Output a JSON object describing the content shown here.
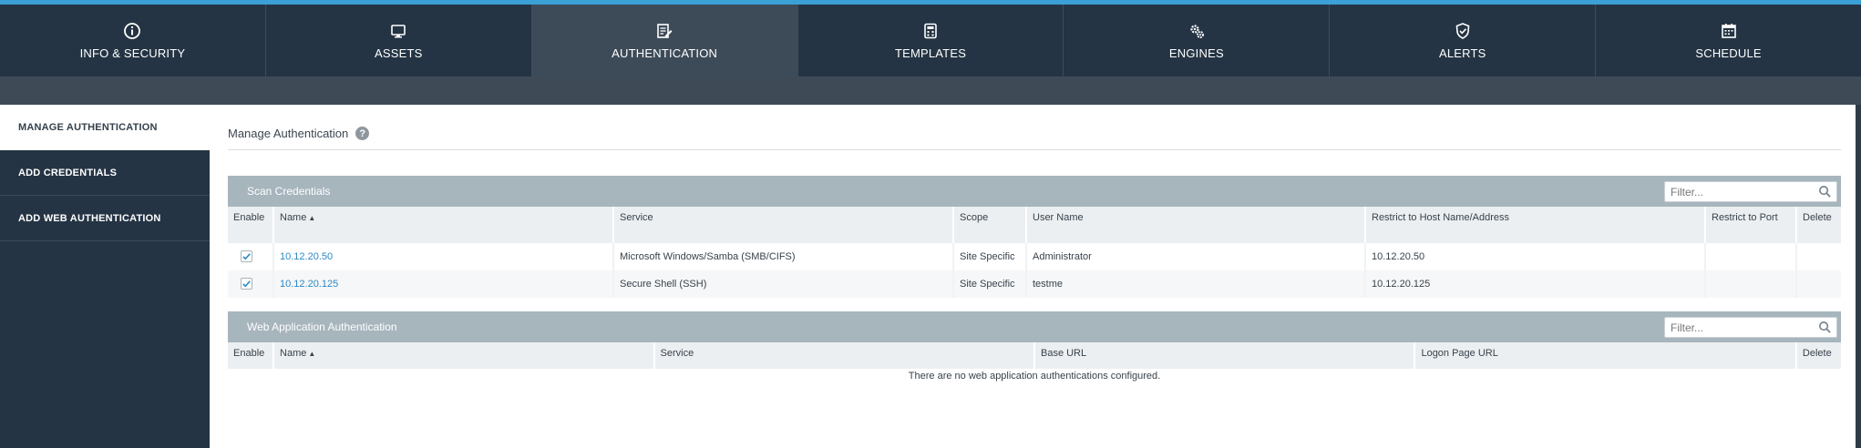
{
  "colors": {
    "accent": "#3aa0d5",
    "nav_bg": "#243444",
    "nav_active": "#3d4b59",
    "section_header": "#a7b5bd",
    "link": "#2a89c6"
  },
  "topnav": [
    {
      "label": "INFO & SECURITY",
      "icon": "info-circle-icon"
    },
    {
      "label": "ASSETS",
      "icon": "monitor-icon"
    },
    {
      "label": "AUTHENTICATION",
      "icon": "edit-document-icon",
      "active": true
    },
    {
      "label": "TEMPLATES",
      "icon": "calculator-icon"
    },
    {
      "label": "ENGINES",
      "icon": "gears-icon"
    },
    {
      "label": "ALERTS",
      "icon": "shield-check-icon"
    },
    {
      "label": "SCHEDULE",
      "icon": "calendar-icon"
    }
  ],
  "sidebar": {
    "items": [
      {
        "label": "MANAGE AUTHENTICATION",
        "active": true
      },
      {
        "label": "ADD CREDENTIALS"
      },
      {
        "label": "ADD WEB AUTHENTICATION"
      }
    ]
  },
  "main": {
    "title": "Manage Authentication",
    "help_icon": "?"
  },
  "scan_credentials": {
    "title": "Scan Credentials",
    "filter_placeholder": "Filter...",
    "columns": [
      "Enable",
      "Name",
      "Service",
      "Scope",
      "User Name",
      "Restrict to Host Name/Address",
      "Restrict to Port",
      "Delete"
    ],
    "sort_glyph": "▲",
    "rows": [
      {
        "enabled": true,
        "name": "10.12.20.50",
        "service": "Microsoft Windows/Samba (SMB/CIFS)",
        "scope": "Site Specific",
        "user": "Administrator",
        "host": "10.12.20.50",
        "port": "",
        "delete": ""
      },
      {
        "enabled": true,
        "name": "10.12.20.125",
        "service": "Secure Shell (SSH)",
        "scope": "Site Specific",
        "user": "testme",
        "host": "10.12.20.125",
        "port": "",
        "delete": ""
      }
    ]
  },
  "web_auth": {
    "title": "Web Application Authentication",
    "filter_placeholder": "Filter...",
    "columns": [
      "Enable",
      "Name",
      "Service",
      "Base URL",
      "Logon Page URL",
      "Delete"
    ],
    "sort_glyph": "▲",
    "empty_message": "There are no web application authentications configured."
  }
}
